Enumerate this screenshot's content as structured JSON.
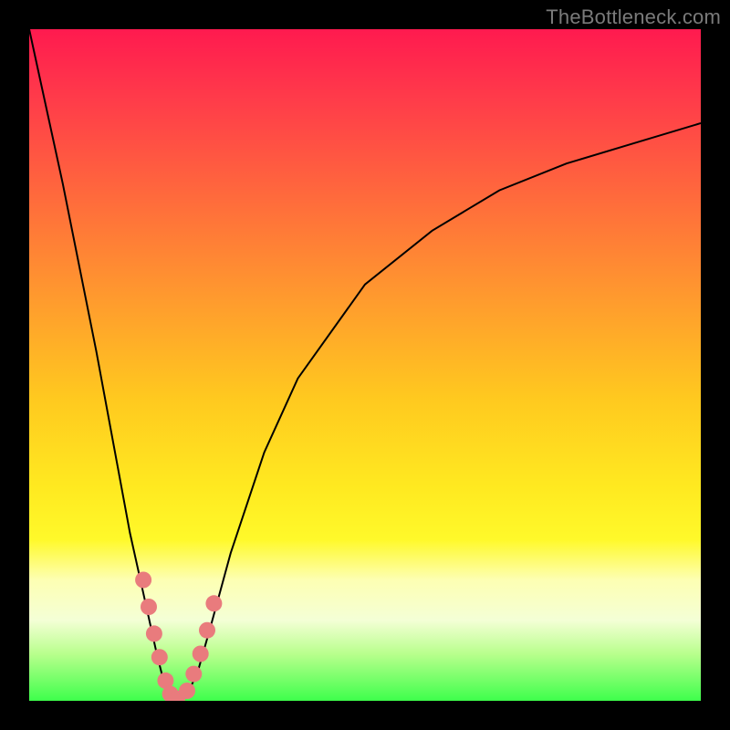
{
  "watermark": "TheBottleneck.com",
  "chart_data": {
    "type": "line",
    "title": "",
    "xlabel": "",
    "ylabel": "",
    "xlim": [
      0,
      100
    ],
    "ylim": [
      0,
      100
    ],
    "grid": false,
    "series": [
      {
        "name": "bottleneck_curve",
        "x": [
          0,
          5,
          10,
          15,
          17,
          19,
          20,
          21,
          22,
          23,
          24,
          25,
          27,
          30,
          35,
          40,
          50,
          60,
          70,
          80,
          90,
          100
        ],
        "values": [
          100,
          77,
          52,
          25,
          16,
          7,
          3,
          0.3,
          0,
          0.3,
          2,
          4,
          11,
          22,
          37,
          48,
          62,
          70,
          76,
          80,
          83,
          86
        ]
      }
    ],
    "markers": {
      "name": "highlighted_points",
      "x": [
        17.0,
        17.8,
        18.6,
        19.4,
        20.3,
        21.0,
        22.0,
        23.5,
        24.5,
        25.5,
        26.5,
        27.5
      ],
      "values": [
        18.0,
        14.0,
        10.0,
        6.5,
        3.0,
        1.0,
        0.3,
        1.5,
        4.0,
        7.0,
        10.5,
        14.5
      ]
    },
    "background_gradient": {
      "stops": [
        {
          "pct": 0,
          "color": "#ff1a4f"
        },
        {
          "pct": 25,
          "color": "#ff6a3c"
        },
        {
          "pct": 55,
          "color": "#ffc91f"
        },
        {
          "pct": 80,
          "color": "#fbff8a"
        },
        {
          "pct": 100,
          "color": "#3eff4c"
        }
      ]
    }
  }
}
